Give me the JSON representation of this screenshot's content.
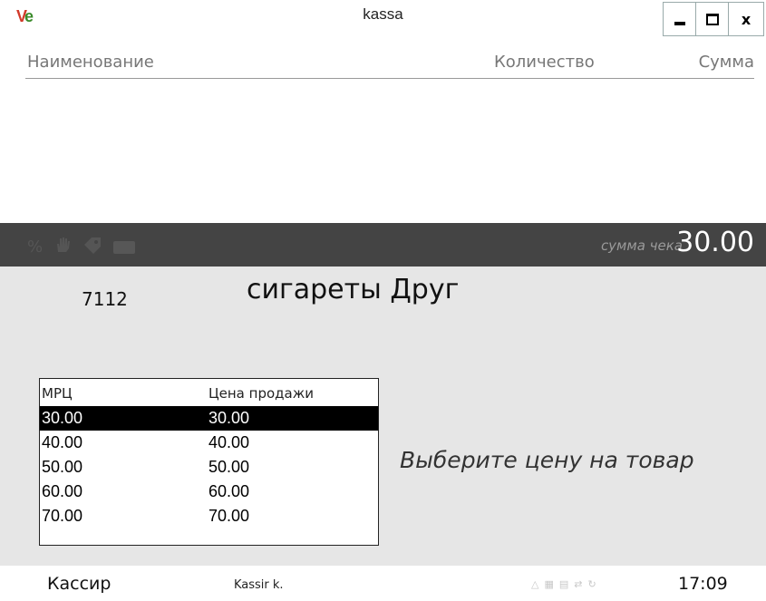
{
  "window": {
    "logo_text": "V",
    "logo_text2": "e",
    "title": "kassa",
    "controls": {
      "close_glyph": "x"
    }
  },
  "header": {
    "col_name": "Наименование",
    "col_qty": "Количество",
    "col_sum": "Сумма"
  },
  "summary_bar": {
    "icons": [
      "percent-icon",
      "hand-icon",
      "tag-icon",
      "card-icon"
    ],
    "percent_glyph": "%",
    "sum_label": "сумма чека",
    "sum_value": "30.00"
  },
  "product": {
    "code": "7112",
    "name": "сигареты Друг"
  },
  "price_table": {
    "headers": [
      "МРЦ",
      "Цена продажи"
    ],
    "rows": [
      {
        "mrp": "30.00",
        "price": "30.00",
        "selected": true
      },
      {
        "mrp": "40.00",
        "price": "40.00",
        "selected": false
      },
      {
        "mrp": "50.00",
        "price": "50.00",
        "selected": false
      },
      {
        "mrp": "60.00",
        "price": "60.00",
        "selected": false
      },
      {
        "mrp": "70.00",
        "price": "70.00",
        "selected": false
      }
    ]
  },
  "prompt": "Выберите цену на товар",
  "status": {
    "cashier_label": "Кассир",
    "cashier_name": "Kassir k.",
    "icons": [
      "drop-icon",
      "network-icon",
      "printer-icon",
      "arrows-icon",
      "sync-icon"
    ],
    "time": "17:09"
  },
  "colors": {
    "dark_bar": "#444444",
    "content_bg": "#e6e6e6",
    "selected_row": "#000000",
    "sum_value": "#ffffff"
  }
}
